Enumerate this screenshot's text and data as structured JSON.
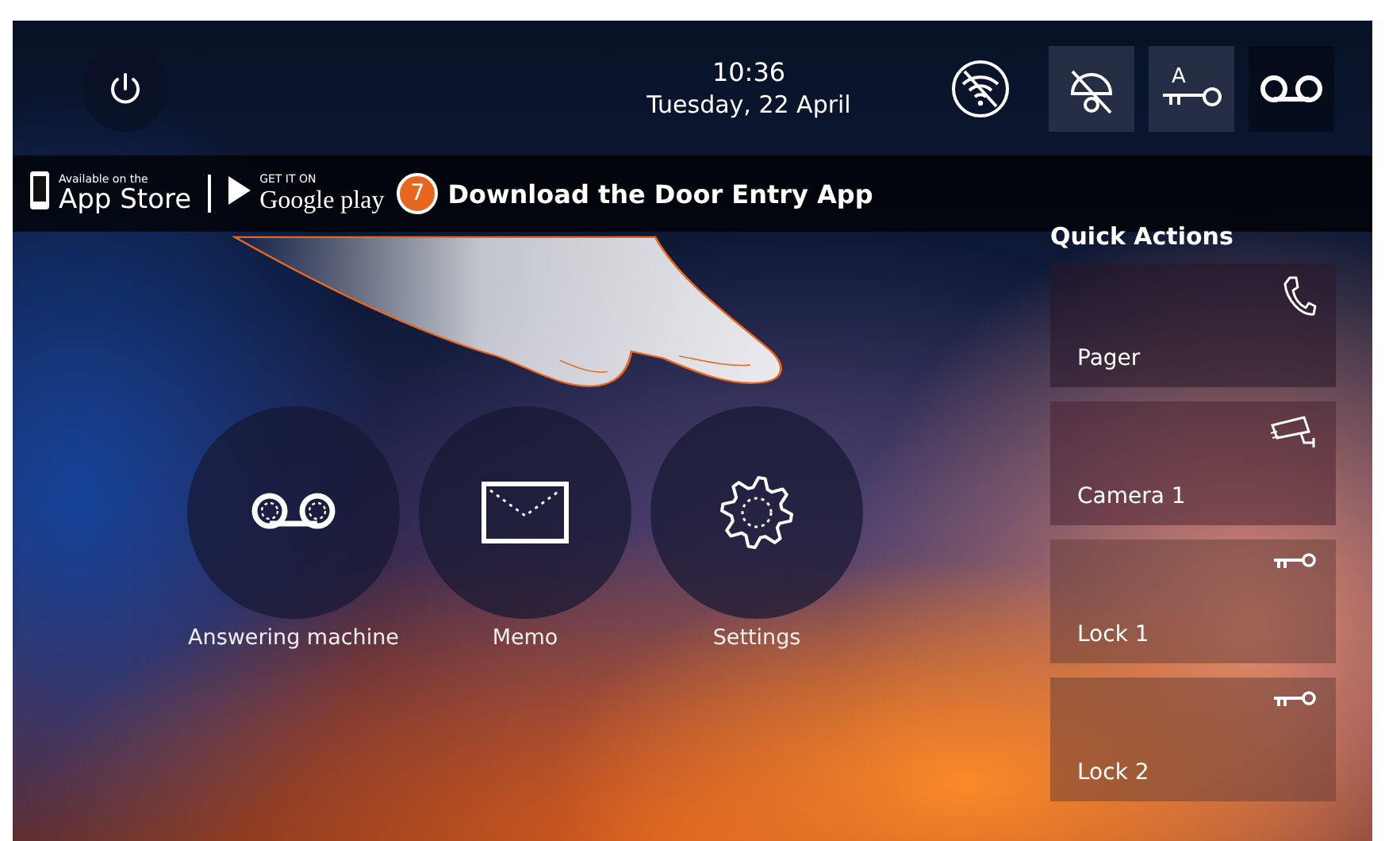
{
  "top_bar": {
    "time": "10:36",
    "date": "Tuesday, 22 April",
    "key_letter": "A"
  },
  "banner": {
    "app_store_small": "Available on the",
    "app_store": "App Store",
    "google_small": "GET IT ON",
    "google": "Google play",
    "step": "7",
    "message": "Download the Door Entry App"
  },
  "main_actions": [
    {
      "kind": "answering_machine",
      "label": "Answering machine"
    },
    {
      "kind": "memo",
      "label": "Memo"
    },
    {
      "kind": "settings",
      "label": "Settings"
    }
  ],
  "quick_actions": {
    "title": "Quick Actions",
    "items": [
      {
        "kind": "pager",
        "label": "Pager"
      },
      {
        "kind": "camera",
        "label": "Camera 1"
      },
      {
        "kind": "lock",
        "label": "Lock 1"
      },
      {
        "kind": "lock",
        "label": "Lock 2"
      }
    ]
  }
}
